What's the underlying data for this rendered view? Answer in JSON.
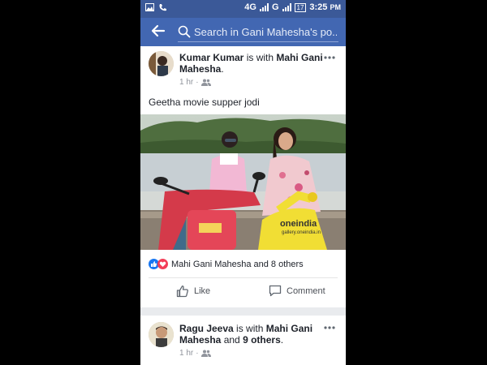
{
  "status_bar": {
    "network": "4G",
    "network2": "G",
    "battery": "17",
    "time": "3:25",
    "ampm": "PM"
  },
  "header": {
    "search_placeholder": "Search in Gani Mahesha's po..."
  },
  "posts": [
    {
      "author": "Kumar Kumar",
      "with_word": " is with ",
      "tagged": "Mahi Gani Mahesha",
      "suffix": ".",
      "time": "1 hr",
      "text": "Geetha movie supper jodi",
      "watermark_brand": "oneindia",
      "watermark_site": "gallery.oneindia.in",
      "reactions": "Mahi Gani Mahesha and 8 others",
      "like_label": "Like",
      "comment_label": "Comment"
    },
    {
      "author": "Ragu Jeeva",
      "with_word": " is with ",
      "tagged": "Mahi Gani Mahesha",
      "and_word": " and ",
      "others": "9 others",
      "suffix": ".",
      "time": "1 hr"
    }
  ],
  "colors": {
    "header_blue": "#4267b2",
    "status_blue": "#3b5998",
    "like_blue": "#1877f2",
    "love_red": "#f33e58"
  }
}
